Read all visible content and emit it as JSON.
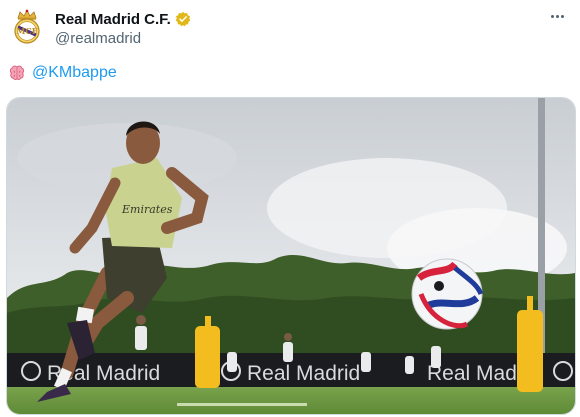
{
  "author": {
    "display_name": "Real Madrid C.F.",
    "handle": "@realmadrid",
    "verified_icon": "gold-verified-badge-icon",
    "avatar_icon": "real-madrid-crest-icon"
  },
  "tweet": {
    "emoji_icon": "brain-emoji-icon",
    "mention": "@KMbappe"
  },
  "menu": {
    "icon": "more-options-icon"
  },
  "media": {
    "shirt_sponsor": "Emirates",
    "board_text": "Real Madrid",
    "board_text_2": "Real Madrid",
    "board_text_3": "Real Madrid"
  },
  "colors": {
    "mention": "#1d9bf0",
    "verified": "#e2b719",
    "muted": "#536471"
  }
}
